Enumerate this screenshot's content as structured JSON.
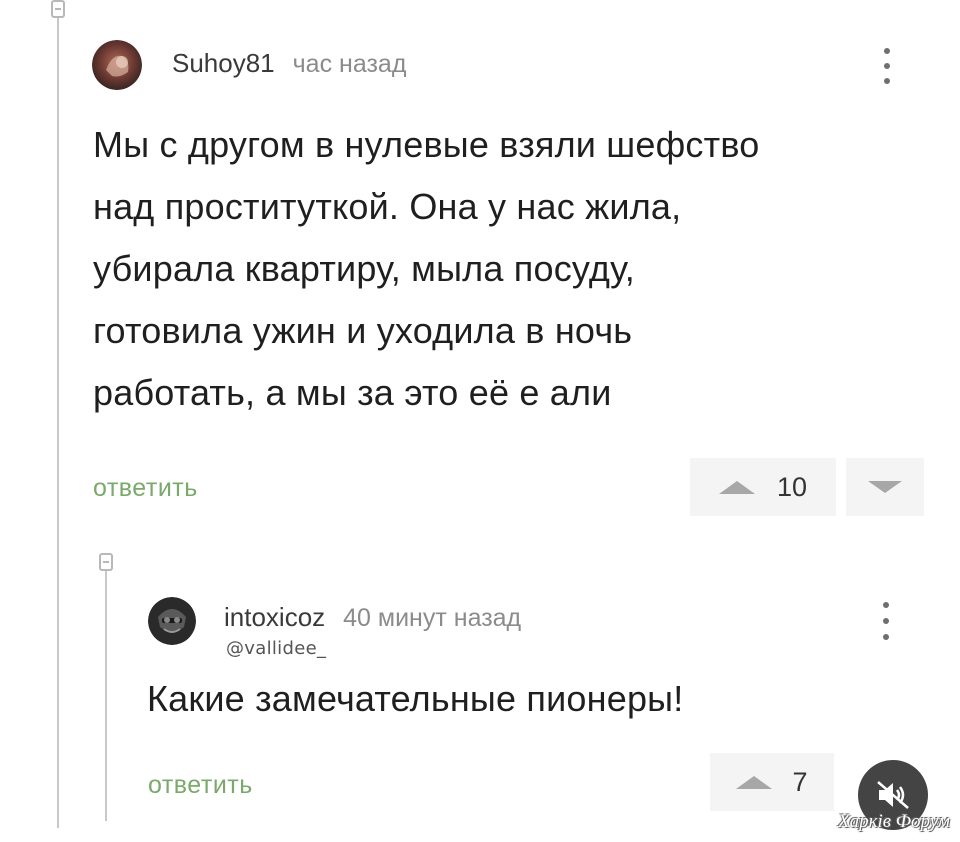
{
  "comments": [
    {
      "username": "Suhoy81",
      "timestamp": "час назад",
      "text_lines": [
        "Мы с другом в нулевые взяли шефство",
        "над проституткой. Она у нас жила,",
        "убирала квартиру, мыла посуду,",
        "готовила ужин и уходила в ночь",
        "работать, а мы за это её е  али"
      ],
      "reply_label": "ответить",
      "votes": "10"
    },
    {
      "username": "intoxicoz",
      "timestamp": "40 минут назад",
      "handle_overlay": "@vallidee_",
      "text_lines": [
        "Какие замечательные пионеры!"
      ],
      "reply_label": "ответить",
      "votes": "7"
    }
  ],
  "watermark": "Харків Форум",
  "icons": {
    "kebab": "kebab-menu-icon",
    "upvote": "upvote-triangle-icon",
    "downvote": "downvote-triangle-icon",
    "collapse": "collapse-thread-icon",
    "mute": "mute-speaker-icon"
  },
  "colors": {
    "reply_link": "#7aa96b",
    "timestamp": "#8b8b8b",
    "vote_bg": "#f4f4f4"
  }
}
